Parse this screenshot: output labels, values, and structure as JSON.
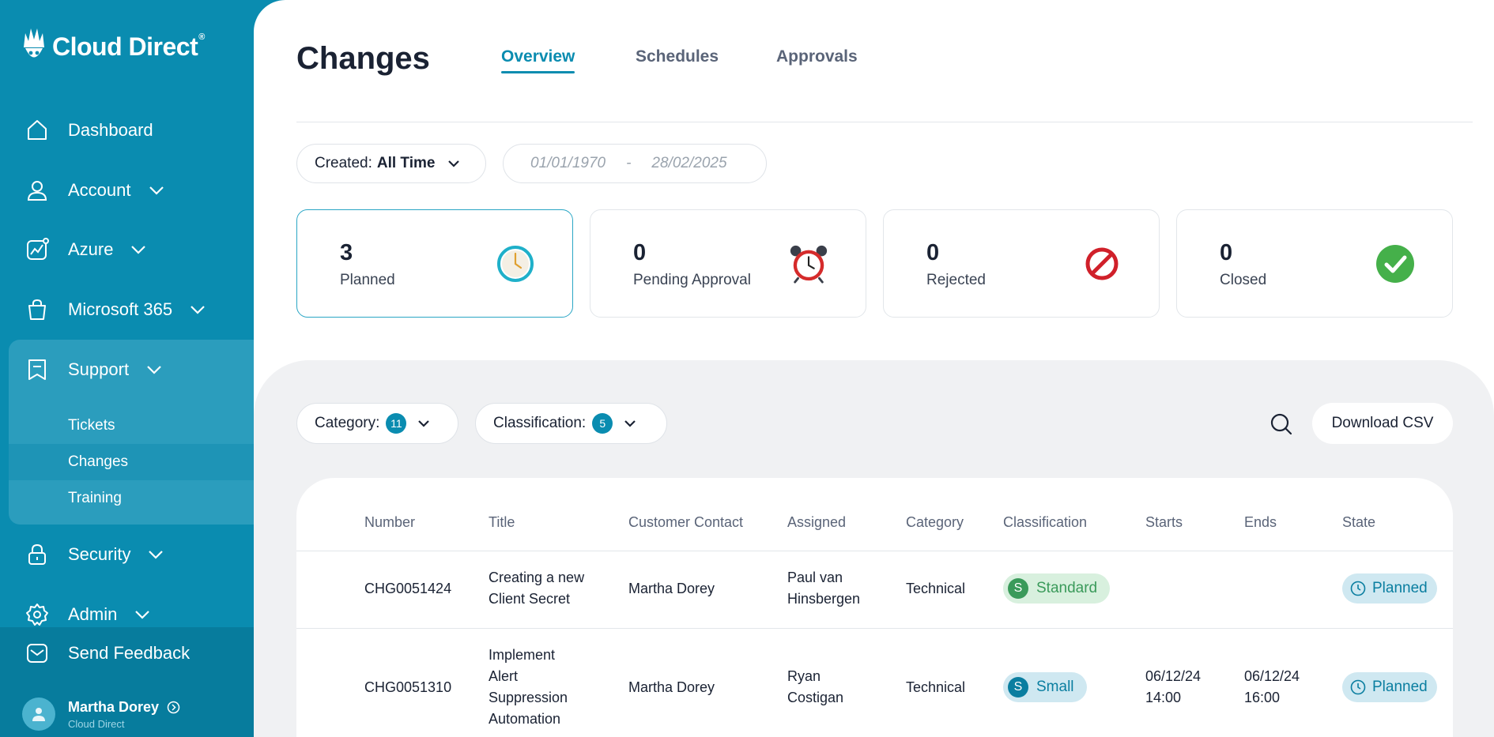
{
  "brand": {
    "name": "Cloud Direct",
    "registered": "®",
    "color": "#0a8cb0"
  },
  "sidebar": {
    "items": [
      {
        "label": "Dashboard",
        "icon": "home-icon"
      },
      {
        "label": "Account",
        "icon": "user-icon"
      },
      {
        "label": "Azure",
        "icon": "chart-icon"
      },
      {
        "label": "Microsoft 365",
        "icon": "bag-icon"
      },
      {
        "label": "Support",
        "icon": "bookmark-icon"
      },
      {
        "label": "Security",
        "icon": "lock-icon"
      },
      {
        "label": "Admin",
        "icon": "gear-icon"
      }
    ],
    "support_sub": [
      {
        "label": "Tickets"
      },
      {
        "label": "Changes"
      },
      {
        "label": "Training"
      }
    ],
    "feedback": "Send Feedback",
    "user": {
      "name": "Martha Dorey",
      "org": "Cloud Direct"
    }
  },
  "header": {
    "title": "Changes",
    "tabs": [
      {
        "label": "Overview"
      },
      {
        "label": "Schedules"
      },
      {
        "label": "Approvals"
      }
    ]
  },
  "filters": {
    "created_label": "Created:",
    "created_value": "All Time",
    "date_from": "01/01/1970",
    "date_sep": "-",
    "date_to": "28/02/2025"
  },
  "summary": [
    {
      "count": "3",
      "label": "Planned",
      "icon": "clock-icon"
    },
    {
      "count": "0",
      "label": "Pending Approval",
      "icon": "alarm-clock-icon"
    },
    {
      "count": "0",
      "label": "Rejected",
      "icon": "prohibited-icon"
    },
    {
      "count": "0",
      "label": "Closed",
      "icon": "check-circle-icon"
    }
  ],
  "table_filters": {
    "category_label": "Category:",
    "category_count": "11",
    "classification_label": "Classification:",
    "classification_count": "5",
    "download": "Download CSV"
  },
  "table": {
    "columns": [
      "Number",
      "Title",
      "Customer Contact",
      "Assigned",
      "Category",
      "Classification",
      "Starts",
      "Ends",
      "State"
    ],
    "rows": [
      {
        "number": "CHG0051424",
        "title": [
          "Creating a new",
          "Client Secret"
        ],
        "contact": "Martha Dorey",
        "assigned": [
          "Paul van",
          "Hinsbergen"
        ],
        "category": "Technical",
        "class_letter": "S",
        "classification": "Standard",
        "starts": [
          "",
          ""
        ],
        "ends": [
          "",
          ""
        ],
        "state": "Planned"
      },
      {
        "number": "CHG0051310",
        "title": [
          "Implement",
          "Alert",
          "Suppression",
          "Automation"
        ],
        "contact": "Martha Dorey",
        "assigned": [
          "Ryan",
          "Costigan"
        ],
        "category": "Technical",
        "class_letter": "S",
        "classification": "Small",
        "starts": [
          "06/12/24",
          "14:00"
        ],
        "ends": [
          "06/12/24",
          "16:00"
        ],
        "state": "Planned"
      }
    ]
  }
}
